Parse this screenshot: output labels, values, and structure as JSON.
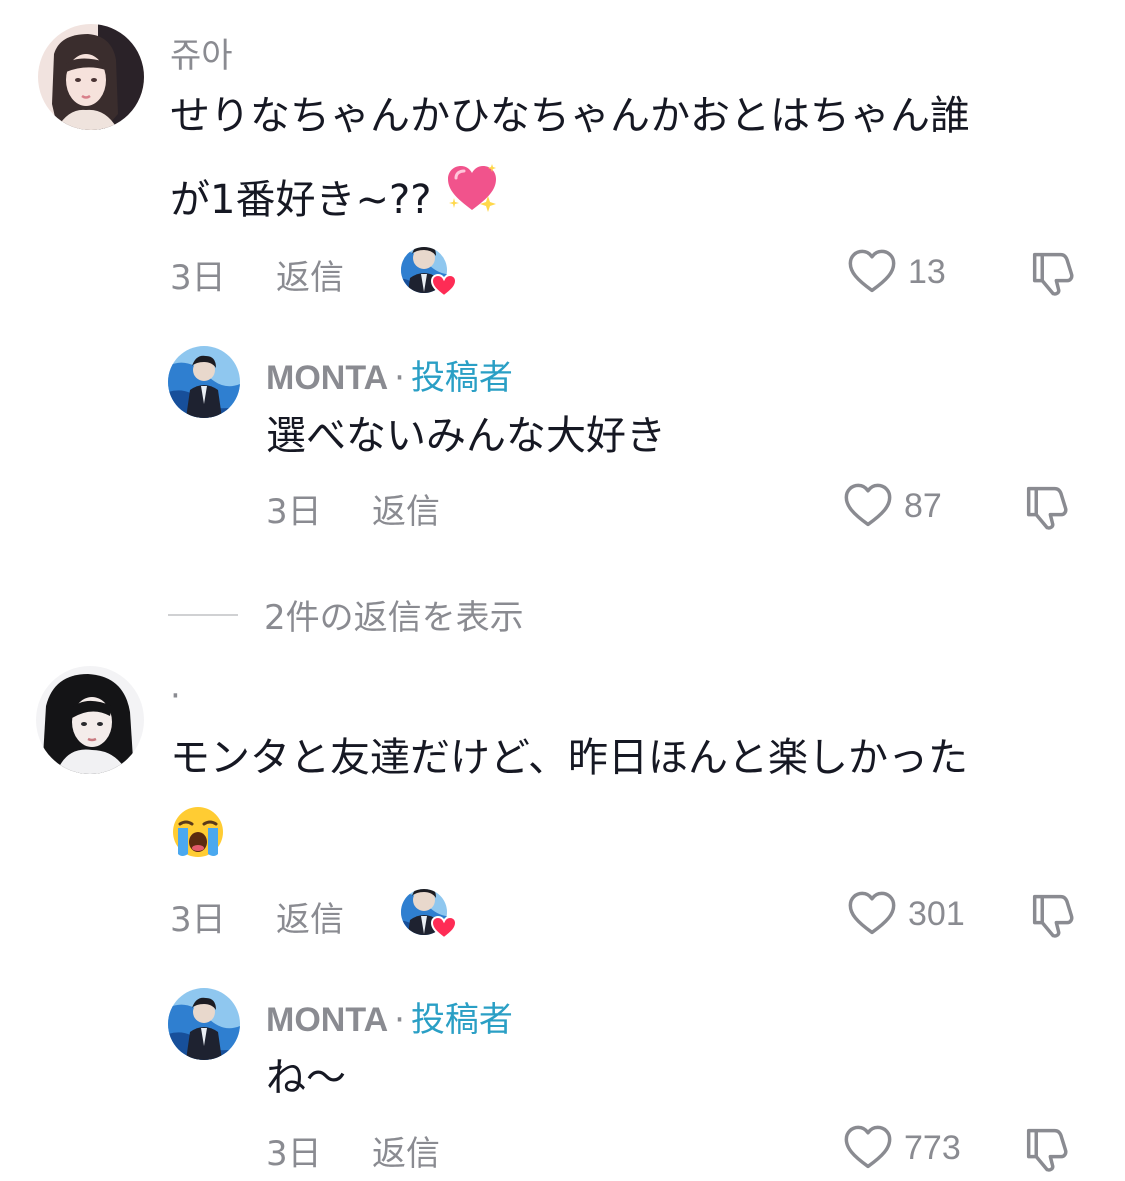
{
  "comments": [
    {
      "username": "쥬아",
      "text_line1": "せりなちゃんかひなちゃんかおとはちゃん誰",
      "text_line2": "が1番好き~??",
      "emoji": "sparkling-heart",
      "time": "3日",
      "reply_label": "返信",
      "likes": "13",
      "reply": {
        "username": "MONTA",
        "separator": "·",
        "creator_tag": "投稿者",
        "text": "選べないみんな大好き",
        "time": "3日",
        "reply_label": "返信",
        "likes": "87"
      },
      "view_replies": "2件の返信を表示"
    },
    {
      "username": "·",
      "text_line1": "モンタと友達だけど、昨日ほんと楽しかった",
      "emoji": "loudly-crying-face",
      "time": "3日",
      "reply_label": "返信",
      "likes": "301",
      "reply": {
        "username": "MONTA",
        "separator": "·",
        "creator_tag": "投稿者",
        "text": "ね〜",
        "time": "3日",
        "reply_label": "返信",
        "likes": "773"
      }
    }
  ],
  "colors": {
    "creator_tag": "#2a9fc5",
    "meta_text": "#8a8b91",
    "body_text": "#161823",
    "heart_badge": "#fe2c55"
  }
}
